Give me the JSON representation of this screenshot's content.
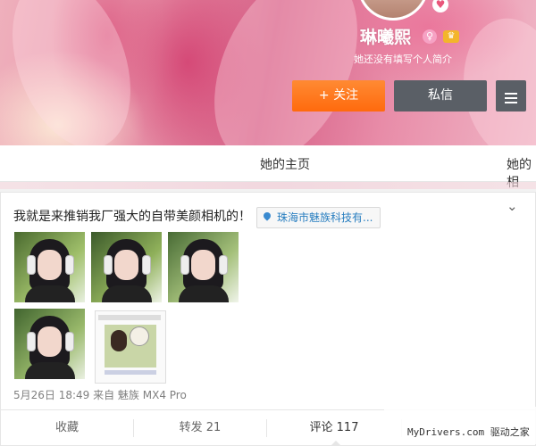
{
  "profile": {
    "username": "琳曦熙",
    "bio": "她还没有填写个人简介",
    "follow_label": "+ 关注",
    "message_label": "私信"
  },
  "tabs": [
    {
      "label": "她的主页"
    },
    {
      "label": "她的相"
    }
  ],
  "post": {
    "text": "我就是来推销我厂强大的自带美颜相机的！",
    "location": "珠海市魅族科技有...",
    "meta": "5月26日 18:49 来自 魅族 MX4 Pro",
    "actions": [
      {
        "label": "收藏"
      },
      {
        "label": "转发 21"
      },
      {
        "label": "评论 117"
      }
    ]
  },
  "watermark": "MyDrivers.com 驱动之家",
  "colors": {
    "accent_orange": "#ff6a0d",
    "dark_button": "#5a5f66",
    "link_blue": "#2a7fc0"
  }
}
